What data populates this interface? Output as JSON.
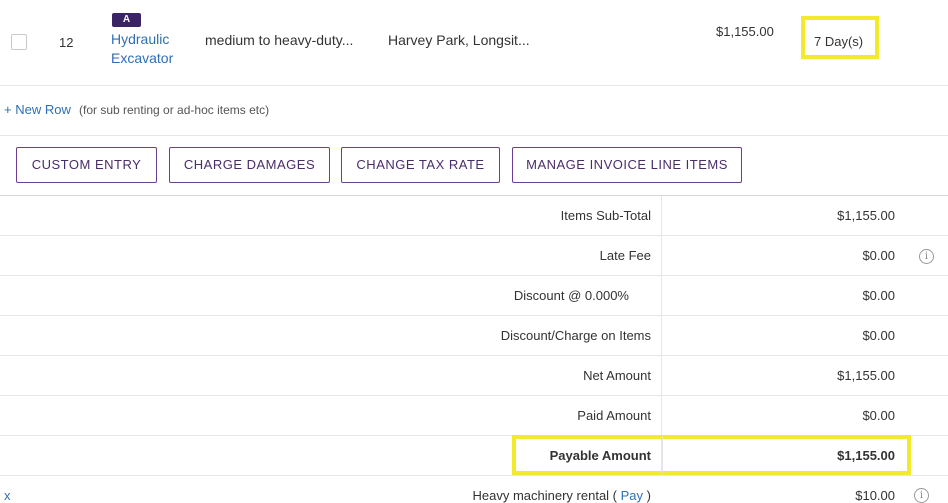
{
  "line_item": {
    "row_number": "12",
    "badge": "A",
    "name": "Hydraulic Excavator",
    "description": "medium to heavy-duty...",
    "location": "Harvey Park, Longsit...",
    "price": "$1,155.00",
    "duration": "7 Day(s)"
  },
  "new_row": {
    "link_label": "+ New Row",
    "hint": "(for sub renting or ad-hoc items etc)"
  },
  "actions": {
    "custom_entry": "CUSTOM ENTRY",
    "charge_damages": "CHARGE DAMAGES",
    "change_tax_rate": "CHANGE TAX RATE",
    "manage_invoice_line_items": "MANAGE INVOICE LINE ITEMS"
  },
  "totals": [
    {
      "label": "Items Sub-Total",
      "value": "$1,155.00"
    },
    {
      "label": "Late Fee",
      "value": "$0.00"
    },
    {
      "label": "Discount @ 0.000%",
      "value": "$0.00"
    },
    {
      "label": "Discount/Charge on Items",
      "value": "$0.00"
    },
    {
      "label": "Net Amount",
      "value": "$1,155.00"
    },
    {
      "label": "Paid Amount",
      "value": "$0.00"
    },
    {
      "label": "Payable Amount",
      "value": "$1,155.00"
    }
  ],
  "extra_charge": {
    "remove_label": "x",
    "label": "Heavy machinery rental (",
    "pay_link": "Pay",
    "label_close": ")",
    "value": "$10.00"
  },
  "icons": {
    "info": "info-icon"
  },
  "colors": {
    "highlight": "#f2ea2a",
    "accent_purple": "#4b2c6b",
    "link_blue": "#2f6fb3",
    "badge_bg": "#3b2466"
  }
}
